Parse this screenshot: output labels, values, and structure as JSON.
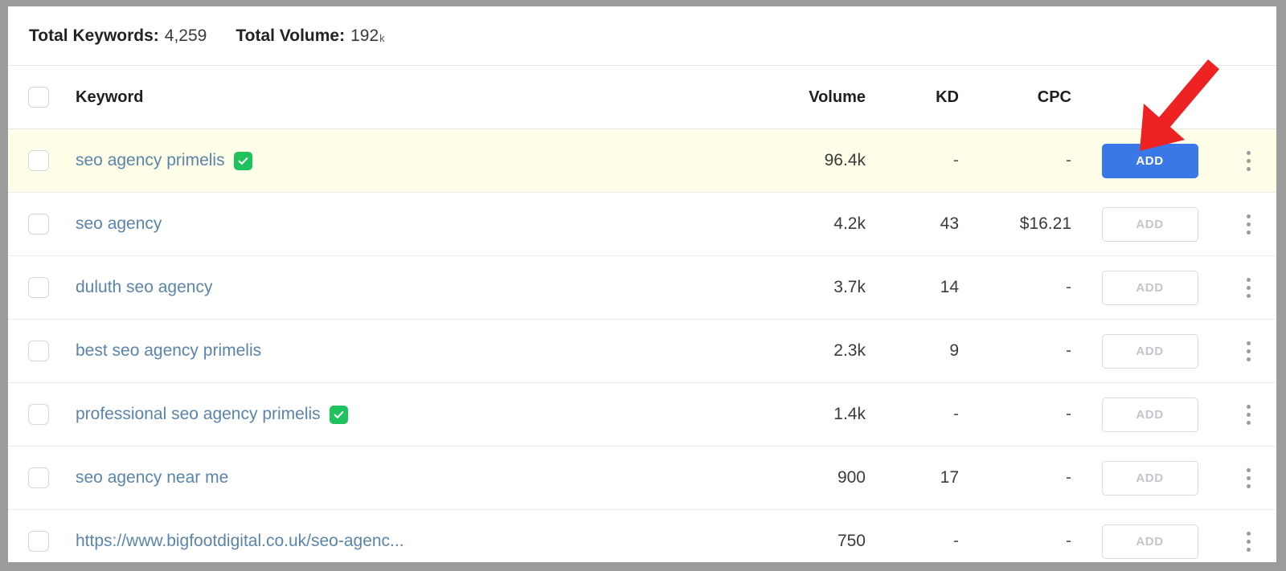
{
  "summary": {
    "keywords_label": "Total Keywords:",
    "keywords_value": "4,259",
    "volume_label": "Total Volume:",
    "volume_value": "192",
    "volume_suffix": "k"
  },
  "table": {
    "columns": {
      "keyword": "Keyword",
      "volume": "Volume",
      "kd": "KD",
      "cpc": "CPC"
    },
    "rows": [
      {
        "keyword": "seo agency primelis",
        "verified": true,
        "volume": "96.4",
        "volume_suffix": "k",
        "kd": "-",
        "cpc": "-",
        "action_label": "ADD",
        "action_state": "primary",
        "highlighted": true
      },
      {
        "keyword": "seo agency",
        "verified": false,
        "volume": "4.2",
        "volume_suffix": "k",
        "kd": "43",
        "cpc": "$16.21",
        "action_label": "ADD",
        "action_state": "secondary",
        "highlighted": false
      },
      {
        "keyword": "duluth seo agency",
        "verified": false,
        "volume": "3.7",
        "volume_suffix": "k",
        "kd": "14",
        "cpc": "-",
        "action_label": "ADD",
        "action_state": "secondary",
        "highlighted": false
      },
      {
        "keyword": "best seo agency primelis",
        "verified": false,
        "volume": "2.3",
        "volume_suffix": "k",
        "kd": "9",
        "cpc": "-",
        "action_label": "ADD",
        "action_state": "secondary",
        "highlighted": false
      },
      {
        "keyword": "professional seo agency primelis",
        "verified": true,
        "volume": "1.4",
        "volume_suffix": "k",
        "kd": "-",
        "cpc": "-",
        "action_label": "ADD",
        "action_state": "secondary",
        "highlighted": false
      },
      {
        "keyword": "seo agency near me",
        "verified": false,
        "volume": "900",
        "volume_suffix": "",
        "kd": "17",
        "cpc": "-",
        "action_label": "ADD",
        "action_state": "secondary",
        "highlighted": false
      },
      {
        "keyword": "https://www.bigfootdigital.co.uk/seo-agenc...",
        "verified": false,
        "volume": "750",
        "volume_suffix": "",
        "kd": "-",
        "cpc": "-",
        "action_label": "ADD",
        "action_state": "secondary",
        "highlighted": false
      }
    ]
  },
  "annotation": {
    "arrow_color": "#ee2222",
    "points_to": "ADD"
  },
  "colors": {
    "primary_button": "#3b78e7",
    "verified_badge": "#1fc25c",
    "row_highlight": "#fdfde8",
    "keyword_link": "#5b84ab",
    "frame": "#9c9c9c"
  }
}
